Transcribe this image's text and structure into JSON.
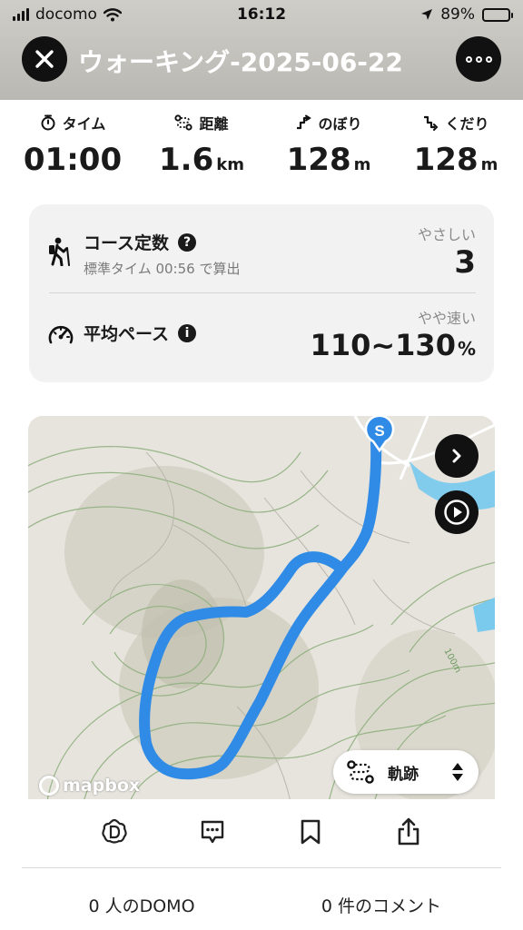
{
  "status_bar": {
    "carrier": "docomo",
    "time": "16:12",
    "battery": "89%",
    "icons": [
      "signal-icon",
      "wifi-icon",
      "location-arrow-icon",
      "battery-icon"
    ]
  },
  "header": {
    "title": "ウォーキング-2025-06-22",
    "close_icon": "close-icon",
    "more_icon": "more-icon"
  },
  "stats": [
    {
      "label": "タイム",
      "icon": "stopwatch-icon",
      "value": "01:00",
      "unit": ""
    },
    {
      "label": "距離",
      "icon": "route-icon",
      "value": "1.6",
      "unit": "km"
    },
    {
      "label": "のぼり",
      "icon": "ascent-icon",
      "value": "128",
      "unit": "m"
    },
    {
      "label": "くだり",
      "icon": "descent-icon",
      "value": "128",
      "unit": "m"
    }
  ],
  "course": {
    "constant_label": "コース定数",
    "constant_sub": "標準タイム 00:56 で算出",
    "difficulty": "やさしい",
    "constant_value": "3",
    "pace_label": "平均ペース",
    "pace_hint": "やや速い",
    "pace_value": "110~130",
    "pace_unit": "%"
  },
  "map": {
    "start_marker": "S",
    "contour_label": "100m",
    "attribution": "mapbox",
    "track_mode": "軌跡",
    "colors": {
      "route": "#2f8be6",
      "water": "#6ec7ef",
      "terrain": "#e6e4dd"
    }
  },
  "actions": {
    "domo_count": "0 人のDOMO",
    "comment_count": "0 件のコメント",
    "icons": [
      "domo-icon",
      "comment-icon",
      "bookmark-icon",
      "share-icon"
    ]
  }
}
